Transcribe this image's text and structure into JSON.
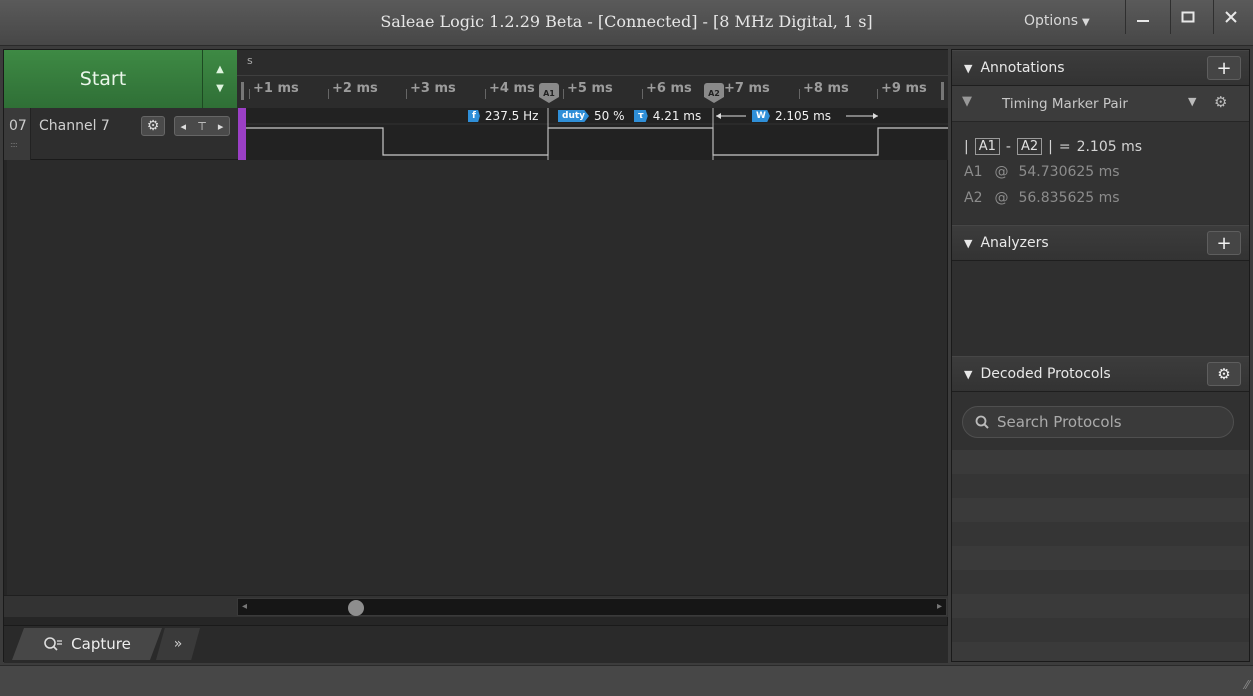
{
  "window": {
    "title": "Saleae Logic 1.2.29 Beta - [Connected] - [8 MHz Digital, 1 s]",
    "options_label": "Options",
    "min_icon": "minimize-icon",
    "max_icon": "maximize-icon",
    "close_icon": "close-icon"
  },
  "toolbar": {
    "start_label": "Start"
  },
  "timeline": {
    "unit_label": "s",
    "ticks": [
      "+1 ms",
      "+2 ms",
      "+3 ms",
      "+4 ms",
      "+5 ms",
      "+6 ms",
      "+7 ms",
      "+8 ms",
      "+9 ms"
    ],
    "marker_a1": "A1",
    "marker_a2": "A2"
  },
  "channel": {
    "number": "07",
    "name": "Channel 7",
    "color": "#9b3fc6"
  },
  "measurements": {
    "freq_tag": "f",
    "freq_value": "237.5 Hz",
    "duty_tag": "duty",
    "duty_value": "50 %",
    "period_tag": "τ",
    "period_value": "4.21 ms",
    "width_tag": "W",
    "width_value": "2.105 ms"
  },
  "tabs": {
    "capture_label": "Capture",
    "more_label": "»"
  },
  "annotations": {
    "title": "Annotations",
    "marker_type": "Timing Marker Pair",
    "delta_a1": "A1",
    "delta_a2": "A2",
    "delta_value": "2.105 ms",
    "a1_label": "A1",
    "a1_value": "54.730625 ms",
    "a2_label": "A2",
    "a2_value": "56.835625 ms"
  },
  "analyzers": {
    "title": "Analyzers"
  },
  "decoded_protocols": {
    "title": "Decoded Protocols",
    "search_placeholder": "Search Protocols"
  }
}
